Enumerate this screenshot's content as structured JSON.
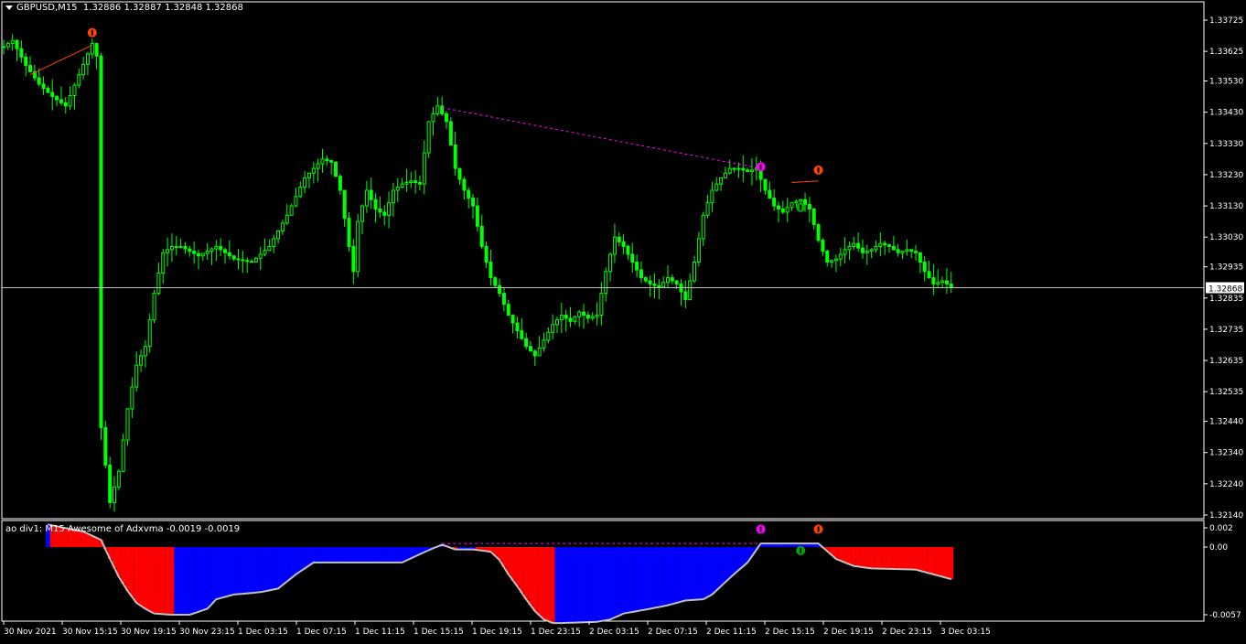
{
  "header": {
    "symbol": "GBPUSD,M15",
    "ohlc": "1.32886 1.32887 1.32848 1.32868"
  },
  "indicator": {
    "label": "ao div1: M15 Awesome of Adxvma -0.0019 -0.0019"
  },
  "chart_data": [
    {
      "type": "candlestick",
      "title": "GBPUSD,M15",
      "y_ticks": [
        "1.33725",
        "1.33625",
        "1.33530",
        "1.33430",
        "1.33330",
        "1.33230",
        "1.33130",
        "1.33030",
        "1.32935",
        "1.32835",
        "1.32735",
        "1.32635",
        "1.32535",
        "1.32440",
        "1.32340",
        "1.32240",
        "1.32140"
      ],
      "ylim": [
        1.3214,
        1.33725
      ],
      "current_price": "1.32868",
      "x_ticks": [
        "30 Nov 2021",
        "30 Nov 15:15",
        "30 Nov 19:15",
        "30 Nov 23:15",
        "1 Dec 03:15",
        "1 Dec 07:15",
        "1 Dec 11:15",
        "1 Dec 15:15",
        "1 Dec 19:15",
        "1 Dec 23:15",
        "2 Dec 03:15",
        "2 Dec 07:15",
        "2 Dec 11:15",
        "2 Dec 15:15",
        "2 Dec 19:15",
        "2 Dec 23:15",
        "3 Dec 03:15"
      ],
      "candle_color": "#00ff00",
      "close_path": [
        [
          0,
          1.3364
        ],
        [
          2,
          1.3366
        ],
        [
          5,
          1.3358
        ],
        [
          8,
          1.3352
        ],
        [
          11,
          1.3348
        ],
        [
          14,
          1.3345
        ],
        [
          17,
          1.3355
        ],
        [
          20,
          1.3365
        ],
        [
          21,
          1.3361
        ],
        [
          22,
          1.3242
        ],
        [
          24,
          1.3218
        ],
        [
          26,
          1.3228
        ],
        [
          28,
          1.3248
        ],
        [
          30,
          1.3262
        ],
        [
          32,
          1.3268
        ],
        [
          34,
          1.3285
        ],
        [
          36,
          1.3298
        ],
        [
          38,
          1.33
        ],
        [
          40,
          1.33
        ],
        [
          44,
          1.3297
        ],
        [
          48,
          1.33
        ],
        [
          52,
          1.3296
        ],
        [
          56,
          1.3295
        ],
        [
          60,
          1.33
        ],
        [
          64,
          1.331
        ],
        [
          68,
          1.3322
        ],
        [
          72,
          1.3328
        ],
        [
          74,
          1.3327
        ],
        [
          76,
          1.3318
        ],
        [
          78,
          1.33
        ],
        [
          79,
          1.3292
        ],
        [
          80,
          1.3308
        ],
        [
          82,
          1.3318
        ],
        [
          84,
          1.3312
        ],
        [
          86,
          1.331
        ],
        [
          88,
          1.3318
        ],
        [
          90,
          1.332
        ],
        [
          92,
          1.3321
        ],
        [
          94,
          1.332
        ],
        [
          96,
          1.334
        ],
        [
          98,
          1.3345
        ],
        [
          100,
          1.334
        ],
        [
          102,
          1.3325
        ],
        [
          104,
          1.3318
        ],
        [
          106,
          1.3313
        ],
        [
          108,
          1.33
        ],
        [
          110,
          1.329
        ],
        [
          112,
          1.3285
        ],
        [
          114,
          1.3278
        ],
        [
          116,
          1.3273
        ],
        [
          118,
          1.3268
        ],
        [
          120,
          1.3265
        ],
        [
          122,
          1.327
        ],
        [
          124,
          1.3275
        ],
        [
          126,
          1.3278
        ],
        [
          128,
          1.3276
        ],
        [
          130,
          1.3279
        ],
        [
          132,
          1.3277
        ],
        [
          134,
          1.3278
        ],
        [
          136,
          1.3292
        ],
        [
          138,
          1.3303
        ],
        [
          140,
          1.33
        ],
        [
          142,
          1.3295
        ],
        [
          144,
          1.329
        ],
        [
          146,
          1.3288
        ],
        [
          148,
          1.3287
        ],
        [
          150,
          1.329
        ],
        [
          152,
          1.3288
        ],
        [
          154,
          1.3283
        ],
        [
          156,
          1.3295
        ],
        [
          158,
          1.331
        ],
        [
          160,
          1.3318
        ],
        [
          162,
          1.3322
        ],
        [
          164,
          1.3325
        ],
        [
          166,
          1.3325
        ],
        [
          168,
          1.3324
        ],
        [
          170,
          1.3325
        ],
        [
          172,
          1.3318
        ],
        [
          174,
          1.3313
        ],
        [
          176,
          1.3311
        ],
        [
          178,
          1.3314
        ],
        [
          180,
          1.3315
        ],
        [
          182,
          1.3312
        ],
        [
          184,
          1.3302
        ],
        [
          186,
          1.3295
        ],
        [
          188,
          1.3296
        ],
        [
          190,
          1.3299
        ],
        [
          192,
          1.3301
        ],
        [
          194,
          1.3298
        ],
        [
          196,
          1.3299
        ],
        [
          198,
          1.3301
        ],
        [
          200,
          1.33
        ],
        [
          202,
          1.3298
        ],
        [
          204,
          1.3299
        ],
        [
          206,
          1.3298
        ],
        [
          208,
          1.3292
        ],
        [
          210,
          1.3288
        ],
        [
          212,
          1.3289
        ],
        [
          214,
          1.3287
        ]
      ],
      "trendlines": [
        {
          "from": [
            6,
            1.3355
          ],
          "to": [
            20,
            1.33645
          ],
          "color": "#ff4500",
          "style": "solid"
        },
        {
          "from": [
            99,
            1.33445
          ],
          "to": [
            171,
            1.3325
          ],
          "color": "#ff00ff",
          "style": "dashed"
        },
        {
          "from": [
            178,
            1.33205
          ],
          "to": [
            184,
            1.3321
          ],
          "color": "#ff4500",
          "style": "solid"
        }
      ],
      "markers": [
        {
          "x": 20,
          "price": 1.33685,
          "color": "#ff4500"
        },
        {
          "x": 171,
          "price": 1.33255,
          "color": "#ff00ff"
        },
        {
          "x": 180,
          "price": 1.33125,
          "color": "#00aa00"
        },
        {
          "x": 184,
          "price": 1.33245,
          "color": "#ff4500"
        }
      ]
    },
    {
      "type": "bar",
      "title": "ao div1: M15 Awesome of Adxvma -0.0019 -0.0019",
      "y_ticks": [
        "0.002",
        "0.00",
        "-0.0057"
      ],
      "ylim": [
        -0.0057,
        0.002
      ],
      "up_color": "#0000ff",
      "down_color": "#ff0000",
      "line_color": "#c0c0c0",
      "signal_path": [
        [
          10,
          0.0019
        ],
        [
          18,
          0.0013
        ],
        [
          22,
          0.0006
        ],
        [
          24,
          -0.001
        ],
        [
          26,
          -0.0025
        ],
        [
          28,
          -0.0037
        ],
        [
          30,
          -0.0047
        ],
        [
          32,
          -0.0052
        ],
        [
          34,
          -0.0056
        ],
        [
          38,
          -0.0057
        ],
        [
          42,
          -0.0057
        ],
        [
          46,
          -0.0052
        ],
        [
          48,
          -0.0044
        ],
        [
          52,
          -0.004
        ],
        [
          58,
          -0.0038
        ],
        [
          62,
          -0.0035
        ],
        [
          66,
          -0.0023
        ],
        [
          70,
          -0.0013
        ],
        [
          74,
          -0.0013
        ],
        [
          90,
          -0.0013
        ],
        [
          94,
          -0.0006
        ],
        [
          97,
          -0.0001
        ],
        [
          99,
          0.0002
        ],
        [
          102,
          -0.0002
        ],
        [
          106,
          -0.0002
        ],
        [
          110,
          -0.0004
        ],
        [
          112,
          -0.0011
        ],
        [
          114,
          -0.0023
        ],
        [
          116,
          -0.0033
        ],
        [
          118,
          -0.0044
        ],
        [
          120,
          -0.0054
        ],
        [
          122,
          -0.0061
        ],
        [
          124,
          -0.0064
        ],
        [
          126,
          -0.0064
        ],
        [
          134,
          -0.0063
        ],
        [
          137,
          -0.0061
        ],
        [
          140,
          -0.0056
        ],
        [
          146,
          -0.0052
        ],
        [
          150,
          -0.0049
        ],
        [
          154,
          -0.0045
        ],
        [
          158,
          -0.0044
        ],
        [
          160,
          -0.004
        ],
        [
          164,
          -0.0026
        ],
        [
          168,
          -0.0013
        ],
        [
          171,
          0.0003
        ],
        [
          176,
          0.0003
        ],
        [
          180,
          0.0003
        ],
        [
          182,
          0.0003
        ],
        [
          184,
          0.0003
        ],
        [
          188,
          -0.001
        ],
        [
          192,
          -0.0016
        ],
        [
          196,
          -0.0018
        ],
        [
          206,
          -0.0019
        ],
        [
          210,
          -0.0023
        ],
        [
          214,
          -0.0027
        ]
      ],
      "trendline": {
        "from": [
          99,
          0.0003
        ],
        "to": [
          171,
          0.0003
        ],
        "color": "#ff00ff",
        "style": "dashed"
      },
      "markers": [
        {
          "x": 171,
          "value": 0.0015,
          "color": "#ff00ff"
        },
        {
          "x": 180,
          "value": -0.0003,
          "color": "#00aa00"
        },
        {
          "x": 184,
          "value": 0.0015,
          "color": "#ff4500"
        }
      ]
    }
  ]
}
